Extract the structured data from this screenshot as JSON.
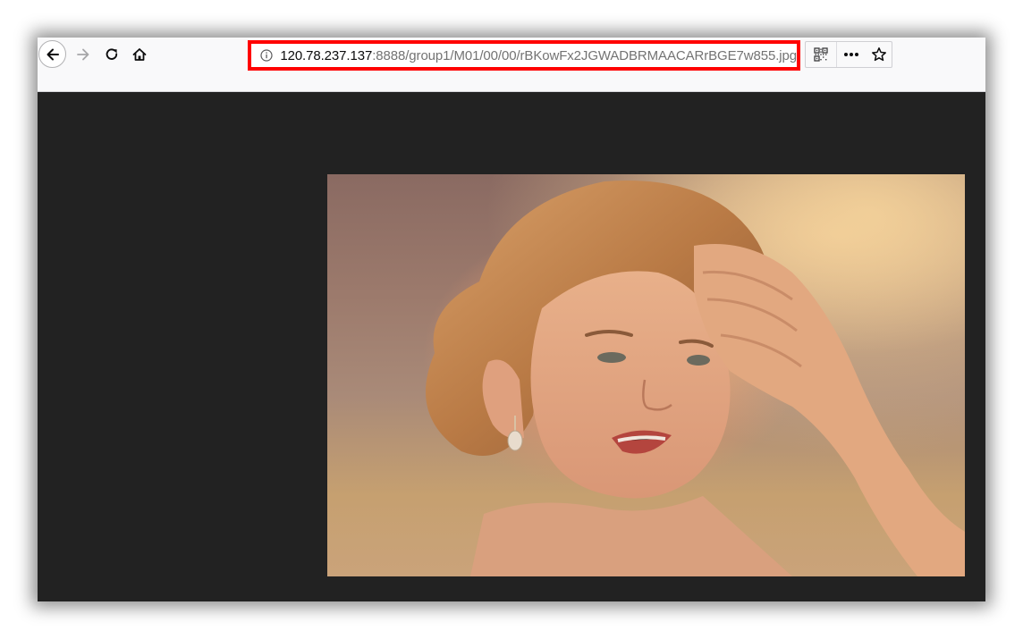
{
  "browser": {
    "url_host": "120.78.237.137",
    "url_path": ":8888/group1/M01/00/00/rBKowFx2JGWADBRMAACARrBGE7w855.jpg",
    "icons": {
      "back": "arrow-left-icon",
      "forward": "arrow-right-icon",
      "reload": "reload-icon",
      "home": "home-icon",
      "site_info": "info-icon",
      "qr": "qr-code-icon",
      "more": "more-dots-icon",
      "bookmark": "star-icon"
    },
    "colors": {
      "highlight": "#ff0000",
      "viewer_background": "#222222",
      "toolbar_background": "#f9f9fa"
    }
  },
  "viewer": {
    "image_description": "photo of a woman with wavy blonde hair holding her hand to her forehead"
  }
}
